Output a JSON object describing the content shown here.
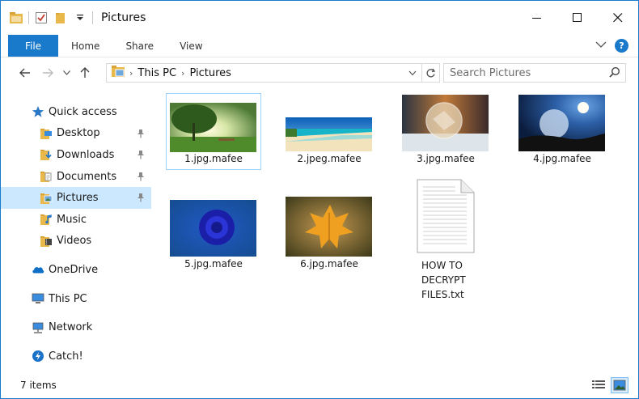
{
  "window": {
    "title": "Pictures",
    "controls": {
      "minimize": "—",
      "maximize": "☐",
      "close": "✕"
    }
  },
  "ribbon": {
    "tabs": [
      {
        "label": "File",
        "active": true
      },
      {
        "label": "Home"
      },
      {
        "label": "Share"
      },
      {
        "label": "View"
      }
    ],
    "help_label": "?"
  },
  "address": {
    "crumbs": [
      "This PC",
      "Pictures"
    ],
    "search_placeholder": "Search Pictures"
  },
  "nav": {
    "quick_access": "Quick access",
    "items": [
      {
        "label": "Desktop",
        "icon": "desktop-folder-icon",
        "pinned": true
      },
      {
        "label": "Downloads",
        "icon": "downloads-folder-icon",
        "pinned": true
      },
      {
        "label": "Documents",
        "icon": "documents-folder-icon",
        "pinned": true
      },
      {
        "label": "Pictures",
        "icon": "pictures-folder-icon",
        "pinned": true,
        "selected": true
      },
      {
        "label": "Music",
        "icon": "music-folder-icon",
        "pinned": false
      },
      {
        "label": "Videos",
        "icon": "videos-folder-icon",
        "pinned": false
      }
    ],
    "onedrive": "OneDrive",
    "thispc": "This PC",
    "network": "Network",
    "catch": "Catch!"
  },
  "files": [
    {
      "name": "1.jpg.mafee",
      "thumb": "forest-sunrise",
      "selected": true
    },
    {
      "name": "2.jpeg.mafee",
      "thumb": "tropical-beach"
    },
    {
      "name": "3.jpg.mafee",
      "thumb": "frozen-bubble"
    },
    {
      "name": "4.jpg.mafee",
      "thumb": "bubble-night"
    },
    {
      "name": "5.jpg.mafee",
      "thumb": "blue-rose"
    },
    {
      "name": "6.jpg.mafee",
      "thumb": "autumn-leaf"
    },
    {
      "name_lines": [
        "HOW TO",
        "DECRYPT",
        "FILES.txt"
      ],
      "thumb": "text-document"
    }
  ],
  "status": {
    "item_count": "7 items"
  },
  "colors": {
    "accent": "#1979ca",
    "selection": "#cce8ff",
    "folder": "#e8b84a"
  }
}
